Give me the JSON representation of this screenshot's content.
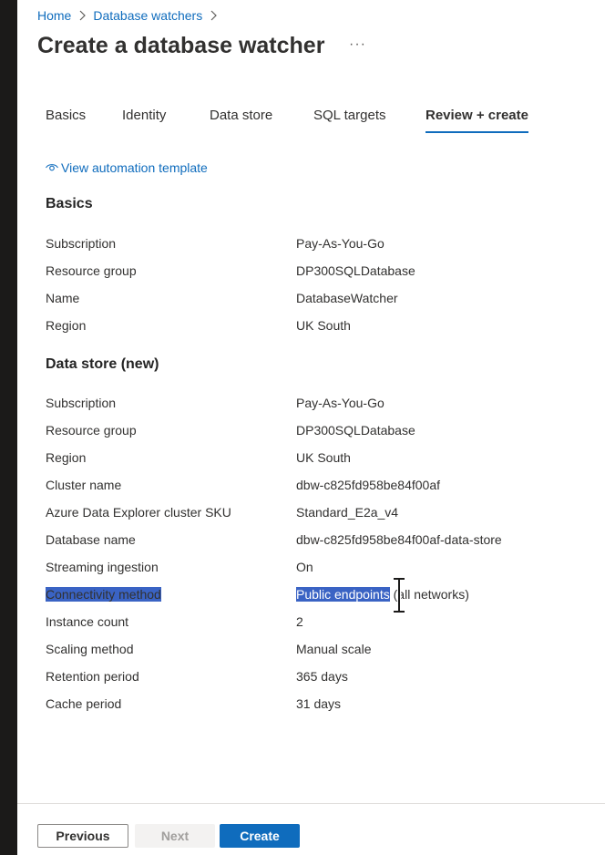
{
  "breadcrumb": {
    "home": "Home",
    "parent": "Database watchers"
  },
  "page": {
    "title": "Create a database watcher",
    "more": "···"
  },
  "tabs": [
    {
      "label": "Basics"
    },
    {
      "label": "Identity"
    },
    {
      "label": "Data store"
    },
    {
      "label": "SQL targets"
    },
    {
      "label": "Review + create",
      "active": true
    }
  ],
  "automation_link": "View automation template",
  "basics": {
    "heading": "Basics",
    "rows": [
      {
        "label": "Subscription",
        "value": "Pay-As-You-Go"
      },
      {
        "label": "Resource group",
        "value": "DP300SQLDatabase"
      },
      {
        "label": "Name",
        "value": "DatabaseWatcher"
      },
      {
        "label": "Region",
        "value": "UK South"
      }
    ]
  },
  "data_store": {
    "heading": "Data store (new)",
    "rows": [
      {
        "label": "Subscription",
        "value": "Pay-As-You-Go"
      },
      {
        "label": "Resource group",
        "value": "DP300SQLDatabase"
      },
      {
        "label": "Region",
        "value": "UK South"
      },
      {
        "label": "Cluster name",
        "value": "dbw-c825fd958be84f00af"
      },
      {
        "label": "Azure Data Explorer cluster SKU",
        "value": "Standard_E2a_v4"
      },
      {
        "label": "Database name",
        "value": "dbw-c825fd958be84f00af-data-store"
      },
      {
        "label": "Streaming ingestion",
        "value": "On"
      },
      {
        "label": "Connectivity method",
        "value_selected": "Public endpoints",
        "value_rest": " (all networks)"
      },
      {
        "label": "Instance count",
        "value": "2"
      },
      {
        "label": "Scaling method",
        "value": "Manual scale"
      },
      {
        "label": "Retention period",
        "value": "365 days"
      },
      {
        "label": "Cache period",
        "value": "31 days"
      }
    ]
  },
  "footer": {
    "previous": "Previous",
    "next": "Next",
    "create": "Create"
  },
  "colors": {
    "accent": "#0f6cbd",
    "selection": "#3a63c4",
    "left_strip": "#1b1a19"
  },
  "icons": {
    "breadcrumb_separator": "chevron-right-icon",
    "link": "eye-icon",
    "cursor": "text-cursor-icon"
  }
}
